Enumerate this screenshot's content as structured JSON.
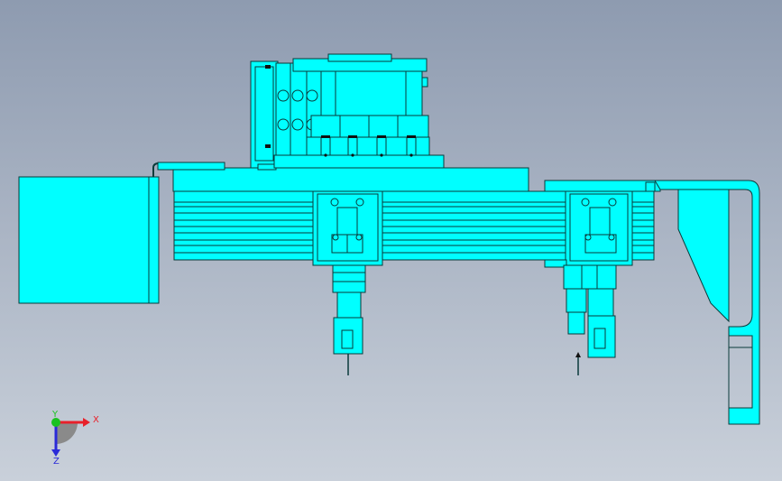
{
  "viewport": {
    "background_top": "#8e9bb0",
    "background_bottom": "#c9d0da"
  },
  "model": {
    "fill_color": "#00ffff",
    "edge_color": "#0a3a3a",
    "bolt_color": "#111111"
  },
  "triad": {
    "x_label": "X",
    "y_label": "Y",
    "z_label": "Z",
    "x_color": "#e8202a",
    "y_color": "#19c21f",
    "z_color": "#2a2ad8"
  }
}
